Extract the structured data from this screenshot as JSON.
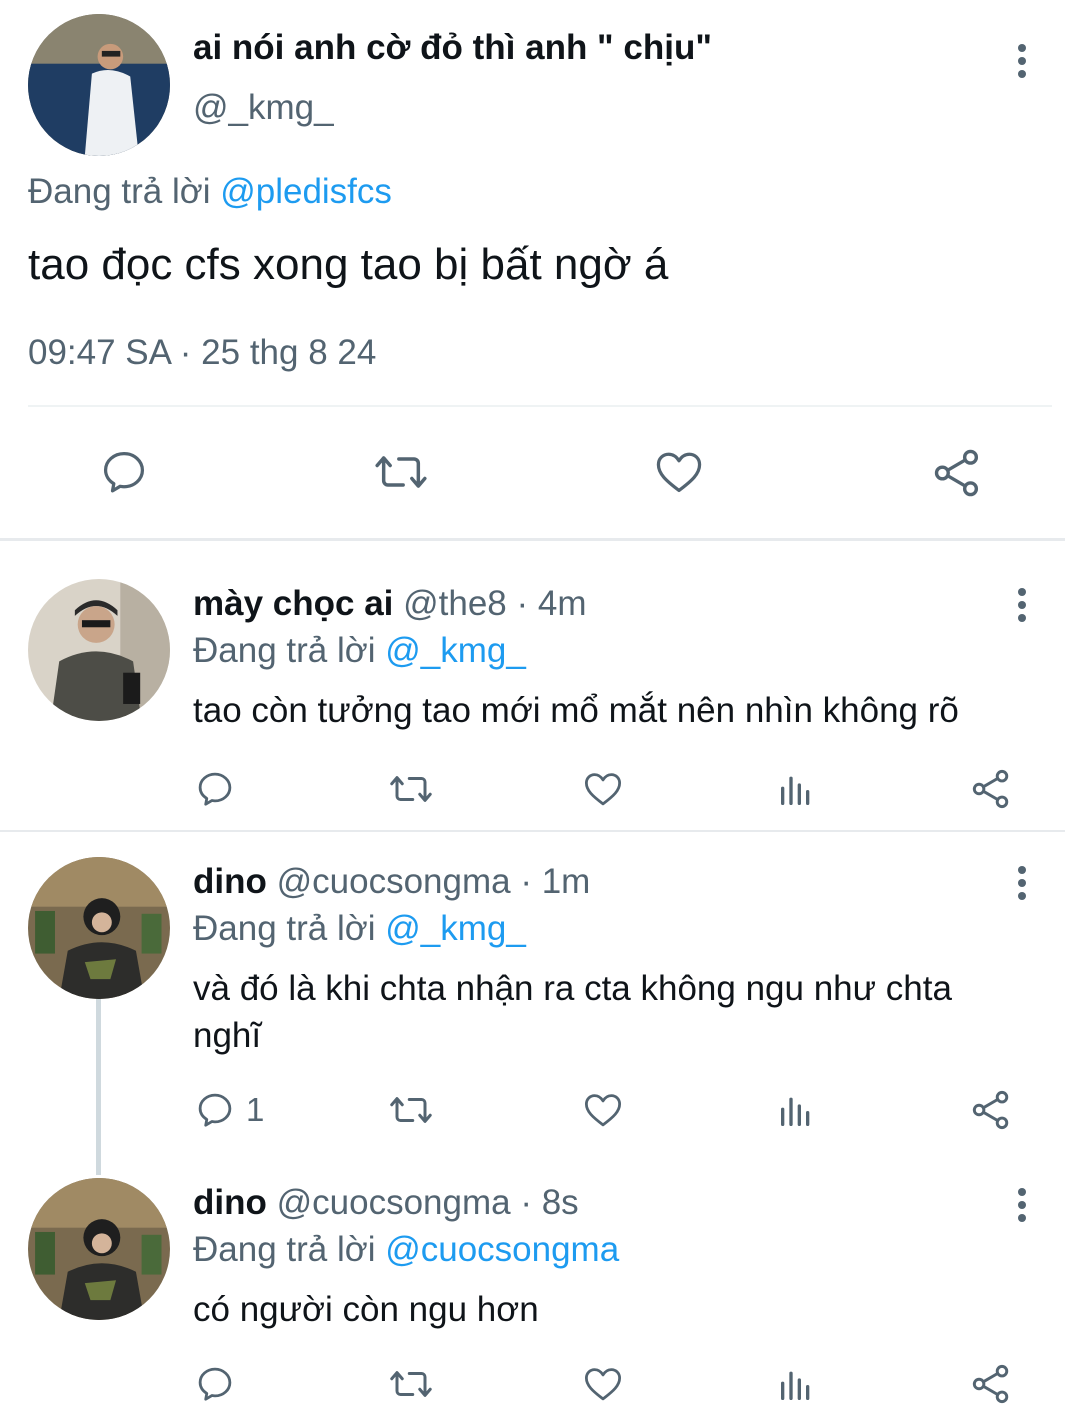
{
  "main_tweet": {
    "display_name": "ai nói anh cờ đỏ thì anh \" chịu\"",
    "handle": "@_kmg_",
    "replying_prefix": "Đang trả lời",
    "replying_to": "@pledisfcs",
    "text": "tao đọc cfs xong tao bị bất ngờ á",
    "timestamp": "09:47 SA · 25 thg 8 24"
  },
  "replies": [
    {
      "display_name": "mày chọc ai",
      "handle": "@the8",
      "time": "· 4m",
      "replying_prefix": "Đang trả lời",
      "replying_to": "@_kmg_",
      "text": "tao còn tưởng tao mới mổ mắt nên nhìn không rõ",
      "reply_count": ""
    },
    {
      "display_name": "dino",
      "handle": "@cuocsongma",
      "time": "· 1m",
      "replying_prefix": "Đang trả lời",
      "replying_to": "@_kmg_",
      "text_line1": "và đó là khi chta nhận ra cta không ngu như chta",
      "text_line2": "nghĩ",
      "reply_count": "1"
    },
    {
      "display_name": "dino",
      "handle": "@cuocsongma",
      "time": "· 8s",
      "replying_prefix": "Đang trả lời",
      "replying_to": "@cuocsongma",
      "text": "có người còn ngu hơn",
      "reply_count": ""
    }
  ],
  "icons": [
    "more-vertical-icon",
    "reply-icon",
    "retweet-icon",
    "like-icon",
    "views-icon",
    "share-icon"
  ],
  "colors": {
    "link": "#1d9bf0",
    "muted": "#536471",
    "text": "#0f1419",
    "separator": "#e7eaed"
  }
}
